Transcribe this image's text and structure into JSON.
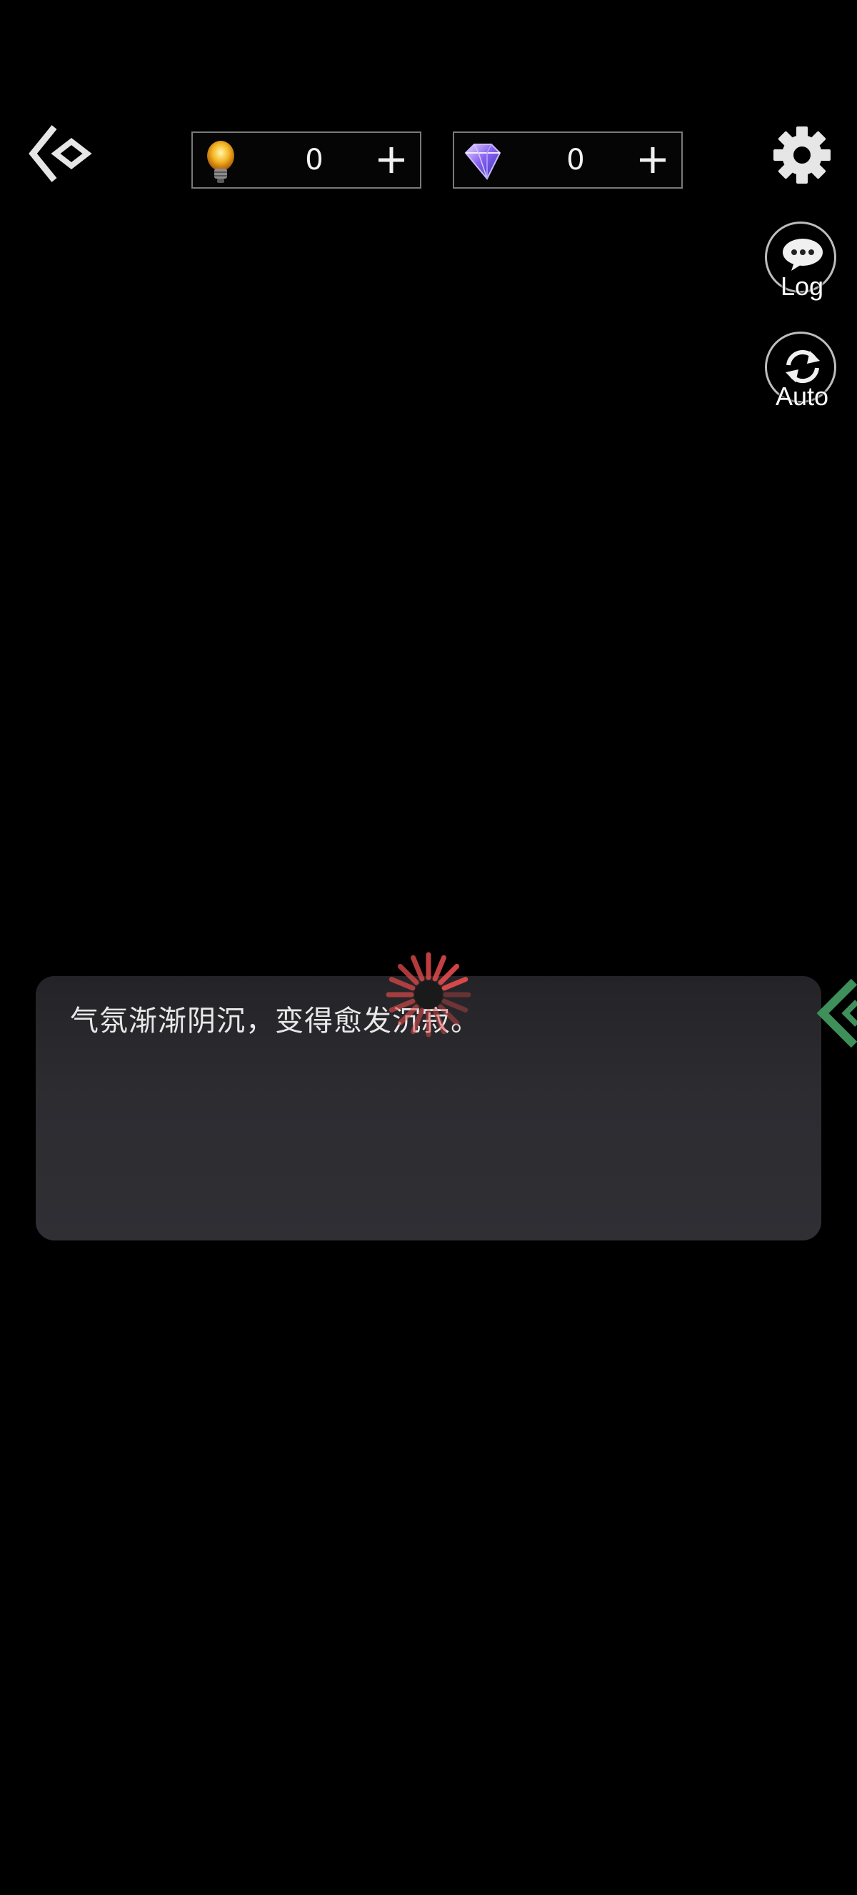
{
  "icons": {
    "back": "back-diamond-icon",
    "bulb": "lightbulb-icon",
    "gem": "diamond-gem-icon",
    "plus": "plus-icon",
    "settings": "gear-icon",
    "log": "chat-bubble-icon",
    "auto": "refresh-icon",
    "loading": "loading-spinner-icon",
    "next": "chevron-left-icon"
  },
  "colors": {
    "background": "#000000",
    "dialog": "#2c2c31",
    "spinner": "#e04a4a",
    "next_arrow": "#3f8f5a"
  },
  "currencies": {
    "bulbs": {
      "value": "0",
      "plus_label": "+"
    },
    "gems": {
      "value": "0",
      "plus_label": "+"
    }
  },
  "side_buttons": {
    "log_label": "Log",
    "auto_label": "Auto"
  },
  "dialog": {
    "text": "气氛渐渐阴沉，变得愈发沉寂。"
  }
}
